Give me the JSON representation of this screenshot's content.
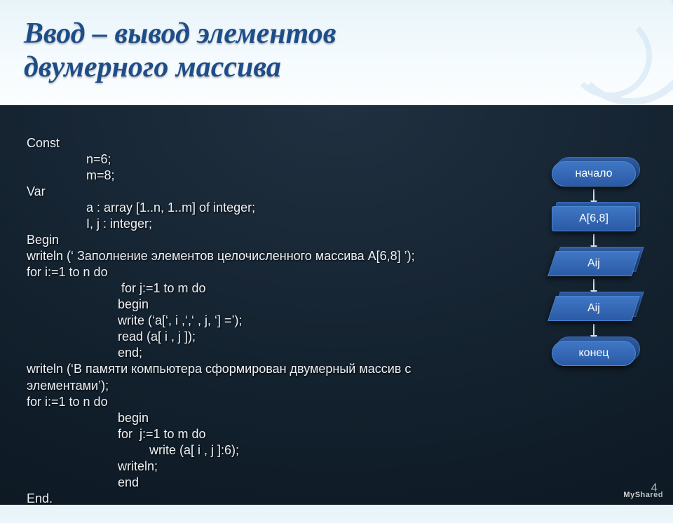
{
  "title": {
    "line1": "Ввод – вывод элементов",
    "line2": "двумерного массива"
  },
  "code": {
    "l1": "Const",
    "l2": "n=6;",
    "l3": "m=8;",
    "l4": "Var",
    "l5": "a : array [1..n, 1..m] of integer;",
    "l6": "I, j : integer;",
    "l7": "Begin",
    "l8": "writeln (‘ Заполнение элементов целочисленного массива A[6,8] ’);",
    "l9": "for i:=1 to n do",
    "l10": " for j:=1 to m do",
    "l11": "begin",
    "l12": "write (‘a[‘, i ,‘,‘ , j, ‘] =’);",
    "l13": "read (a[ i , j ]);",
    "l14": "end;",
    "l15": "writeln (‘В памяти компьютера сформирован двумерный массив с",
    "l16": "элементами’);",
    "l17": "for i:=1 to n do",
    "l18": "begin",
    "l19": "for  j:=1 to m do",
    "l20": "write (a[ i , j ]:6);",
    "l21": "writeln;",
    "l22": "end",
    "l23": "End."
  },
  "flow": {
    "start": "начало",
    "a": "A[6,8]",
    "in": "Aij",
    "out": "Aij",
    "end": "конец"
  },
  "page_number": "4",
  "watermark": "MyShared"
}
